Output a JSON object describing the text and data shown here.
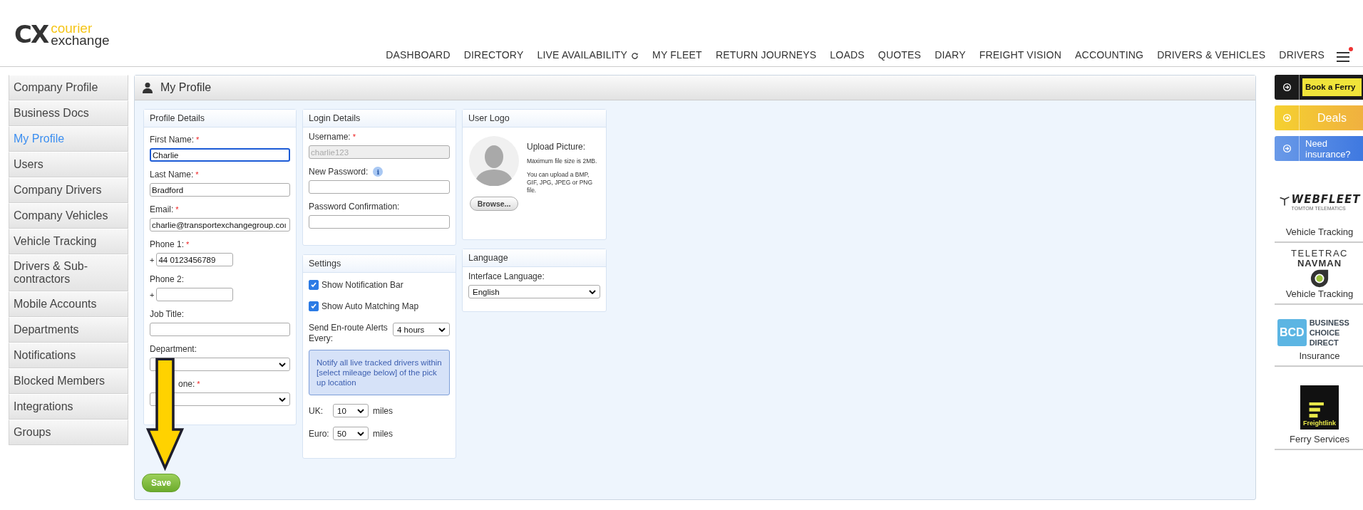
{
  "logo": {
    "mark": "CX",
    "line1": "courier",
    "line2": "exchange"
  },
  "nav": [
    {
      "label": "DASHBOARD",
      "kind": "link"
    },
    {
      "label": "DIRECTORY",
      "kind": "link"
    },
    {
      "label": "LIVE AVAILABILITY",
      "kind": "refresh"
    },
    {
      "label": "MY FLEET",
      "kind": "link"
    },
    {
      "label": "RETURN JOURNEYS",
      "kind": "link"
    },
    {
      "label": "LOADS",
      "kind": "link"
    },
    {
      "label": "QUOTES",
      "kind": "link"
    },
    {
      "label": "DIARY",
      "kind": "link"
    },
    {
      "label": "FREIGHT VISION",
      "kind": "link"
    },
    {
      "label": "ACCOUNTING",
      "kind": "link"
    },
    {
      "label": "DRIVERS & VEHICLES",
      "kind": "link"
    },
    {
      "label": "DRIVERS",
      "kind": "link"
    }
  ],
  "menu": {
    "notification_dot": true
  },
  "sidebar": [
    {
      "label": "Company Profile",
      "selected": false
    },
    {
      "label": "Business Docs",
      "selected": false
    },
    {
      "label": "My Profile",
      "selected": true
    },
    {
      "label": "Users",
      "selected": false
    },
    {
      "label": "Company Drivers",
      "selected": false
    },
    {
      "label": "Company Vehicles",
      "selected": false
    },
    {
      "label": "Vehicle Tracking",
      "selected": false
    },
    {
      "label": "Drivers & Sub-contractors",
      "selected": false
    },
    {
      "label": "Mobile Accounts",
      "selected": false
    },
    {
      "label": "Departments",
      "selected": false
    },
    {
      "label": "Notifications",
      "selected": false
    },
    {
      "label": "Blocked Members",
      "selected": false
    },
    {
      "label": "Integrations",
      "selected": false
    },
    {
      "label": "Groups",
      "selected": false
    }
  ],
  "panel_title": "My Profile",
  "profile_details": {
    "title": "Profile Details",
    "fields": [
      {
        "label": "First Name:",
        "required_mark": "*",
        "kind": "text",
        "value": "Charlie",
        "focused": true
      },
      {
        "label": "Last Name:",
        "required_mark": "*",
        "kind": "text",
        "value": "Bradford",
        "focused": false
      },
      {
        "label": "Email:",
        "required_mark": "*",
        "kind": "text",
        "value": "charlie@transportexchangegroup.coı",
        "focused": false
      },
      {
        "label": "Phone 1:",
        "required_mark": "*",
        "kind": "phone",
        "prefix": "+",
        "value": "44 0123456789",
        "focused": false
      },
      {
        "label": "Phone 2:",
        "kind": "phone",
        "prefix": "+",
        "focused": false
      },
      {
        "label": "Job Title:",
        "kind": "text",
        "focused": false
      },
      {
        "label": "Department:",
        "kind": "select",
        "focused": false
      },
      {
        "label": "one:",
        "required_mark": "*",
        "kind": "select",
        "focused": false
      }
    ]
  },
  "login_details": {
    "title": "Login Details",
    "fields": [
      {
        "label": "Username:",
        "required_mark": "*",
        "value": "charlie123",
        "disabled": true
      },
      {
        "label": "New Password:",
        "info_icon": "i",
        "disabled": false
      },
      {
        "label": "Password Confirmation:",
        "disabled": false
      }
    ]
  },
  "settings": {
    "title": "Settings",
    "checkboxes": [
      {
        "label": "Show Notification Bar",
        "checked": true
      },
      {
        "label": "Show Auto Matching Map",
        "checked": true
      }
    ],
    "alerts_label": "Send En-route Alerts Every:",
    "alerts_value": "4 hours",
    "note": "Notify all live tracked drivers within [select mileage below] of the pick up location",
    "distances": [
      {
        "label": "UK:",
        "value": "10",
        "unit": "miles"
      },
      {
        "label": "Euro:",
        "value": "50",
        "unit": "miles"
      }
    ]
  },
  "user_logo": {
    "title": "User Logo",
    "upload_title": "Upload Picture:",
    "size_note": "Maximum file size is 2MB.",
    "types_note": "You can upload a BMP, GIF, JPG, JPEG or PNG file.",
    "browse": "Browse..."
  },
  "language": {
    "title": "Language",
    "label": "Interface Language:",
    "value": "English"
  },
  "save": "Save",
  "ads": [
    {
      "kind": "ferry",
      "label": "Book a Ferry"
    },
    {
      "kind": "deals",
      "label": "Deals"
    },
    {
      "kind": "insurance",
      "label": "Need insurance?"
    }
  ],
  "partners": [
    {
      "kind": "webfleet",
      "name": "WEBFLEET",
      "sub": "TOMTOM TELEMATICS",
      "caption": "Vehicle Tracking"
    },
    {
      "kind": "teletrac",
      "name": "TELETRAC",
      "sub": "NAVMAN",
      "caption": "Vehicle Tracking"
    },
    {
      "kind": "bcd",
      "name": "BCD",
      "sub": "BUSINESS CHOICE DIRECT",
      "caption": "Insurance"
    },
    {
      "kind": "freightlink",
      "name": "Freightlink",
      "caption": "Ferry Services"
    }
  ]
}
